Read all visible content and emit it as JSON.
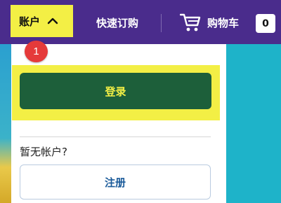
{
  "header": {
    "account_label": "账户",
    "quick_order_label": "快速订购",
    "cart_label": "购物车",
    "cart_count": "0"
  },
  "annotation": {
    "step_number": "1"
  },
  "account_menu": {
    "login_label": "登录",
    "no_account_text": "暂无帐户?",
    "register_label": "注册"
  },
  "colors": {
    "header_bg": "#4a2c8c",
    "highlight": "#f3ef45",
    "login_button_bg": "#1d5f3a",
    "register_text": "#1b5b9a",
    "step_badge": "#e53a3a"
  }
}
